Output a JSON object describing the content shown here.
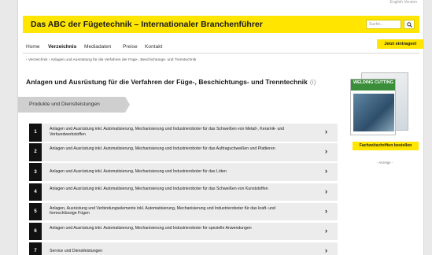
{
  "header": {
    "top_link": "English Version",
    "title": "Das ABC der Fügetechnik – Internationaler Branchenführer",
    "search_placeholder": "Suche..."
  },
  "nav": {
    "items": [
      {
        "label": "Home",
        "active": false
      },
      {
        "label": "Verzeichnis",
        "active": true
      },
      {
        "label": "Mediadaten",
        "active": false
      },
      {
        "label": "Preise",
        "active": false
      },
      {
        "label": "Kontakt",
        "active": false
      }
    ],
    "cta_label": "Jetzt eintragen!"
  },
  "breadcrumb": "› Verzeichnis  › Anlagen und Ausrüstung für die Verfahren der Füge-, Beschichtungs- und Trenntechnik",
  "main": {
    "heading": "Anlagen und Ausrüstung für die Verfahren der Füge-, Beschichtungs- und Trenntechnik",
    "heading_info": "(i)",
    "section_label": "Produkte und Dienstleistungen",
    "categories": [
      {
        "num": "1",
        "text": "Anlagen und Ausrüstung inkl. Automatisierung, Mechanisierung und Industrieroboter für das Schweißen von Metall-, Keramik- und Verbundwerkstoffen"
      },
      {
        "num": "2",
        "text": "Anlagen und Ausrüstung inkl. Automatisierung, Mechanisierung und Industrieroboter für das Auftragschweißen und Plattieren"
      },
      {
        "num": "3",
        "text": "Anlagen und Ausrüstung inkl. Automatisierung, Mechanisierung und Industrieroboter für das Löten"
      },
      {
        "num": "4",
        "text": "Anlagen und Ausrüstung inkl. Automatisierung, Mechanisierung und Industrieroboter für das Schweißen von Kunststoffen"
      },
      {
        "num": "5",
        "text": "Anlagen, Ausrüstung und Verbindungselemente inkl. Automatisierung, Mechanisierung und Industrieroboter für das kraft- und formschlüssige Fügen"
      },
      {
        "num": "6",
        "text": "Anlagen und Ausrüstung inkl. Automatisierung, Mechanisierung und Industrieroboter für spezielle Anwendungen"
      },
      {
        "num": "7",
        "text": "Service und Dienstleistungen"
      }
    ],
    "chevron": "›"
  },
  "sidebar": {
    "magazine_title": "WELDING CUTTING",
    "button_label": "Fachzeitschriften bestellen",
    "ad_label": "- Anzeige -"
  },
  "colors": {
    "accent_yellow": "#ffe500",
    "badge_black": "#111111"
  }
}
